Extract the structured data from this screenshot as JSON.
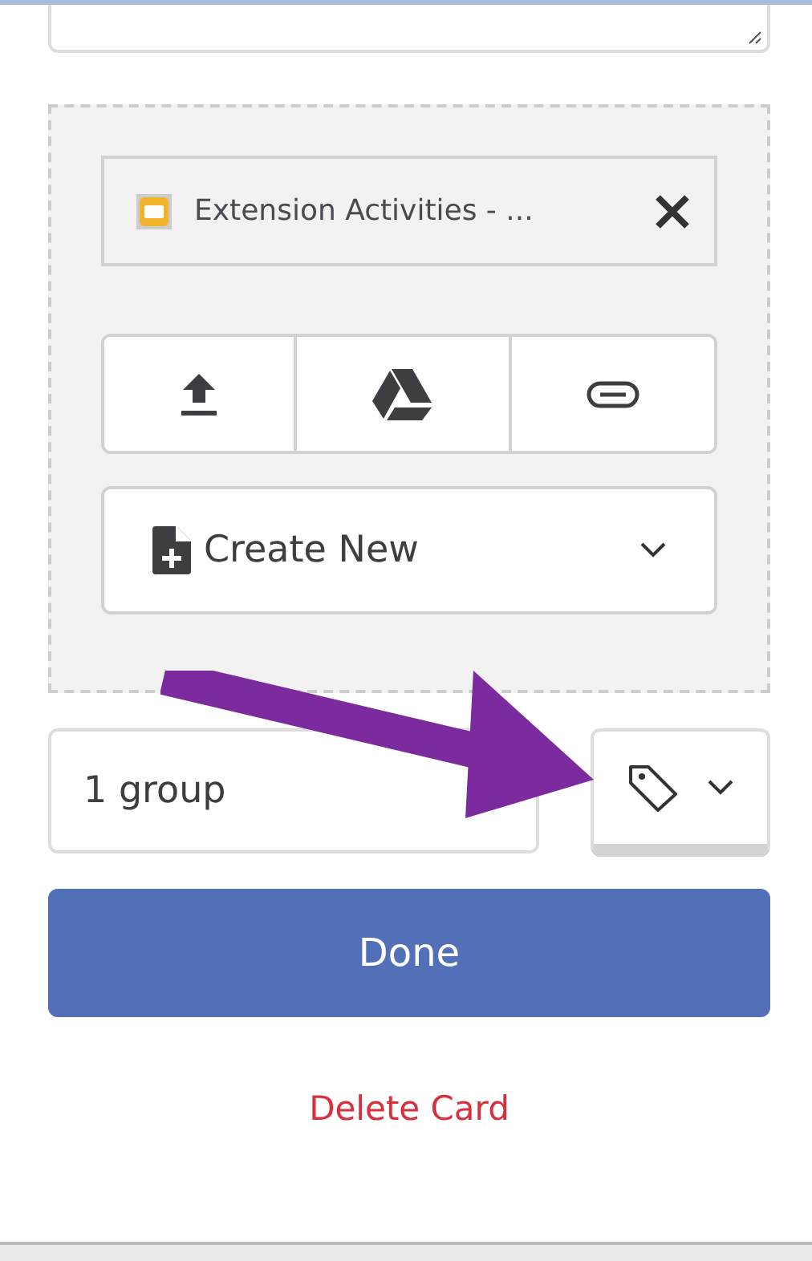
{
  "attachment": {
    "kind": "slides",
    "title": "Extension Activities - ..."
  },
  "create_new": {
    "label": "Create New"
  },
  "groups": {
    "value": "1 group"
  },
  "done_button": "Done",
  "delete_link": "Delete Card"
}
